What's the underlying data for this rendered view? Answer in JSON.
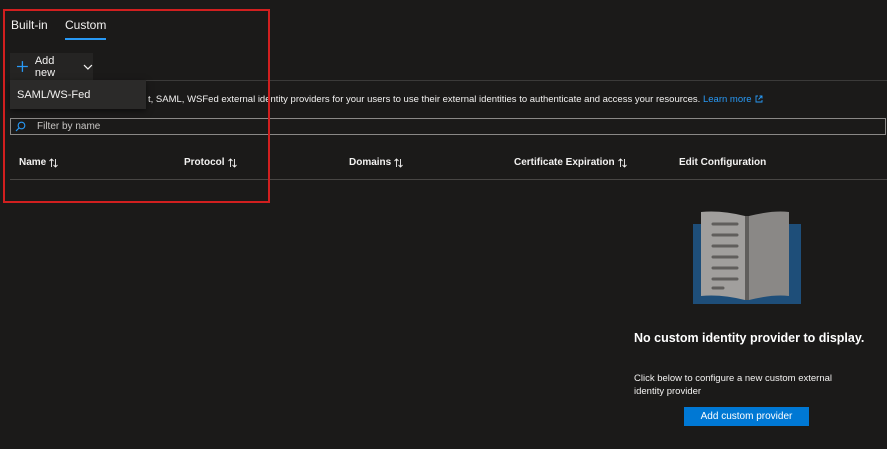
{
  "tabs": [
    {
      "label": "Built-in",
      "active": false
    },
    {
      "label": "Custom",
      "active": true
    }
  ],
  "toolbar": {
    "add_new_label": "Add new",
    "dropdown_items": [
      "SAML/WS-Fed"
    ]
  },
  "description": {
    "text": "t, SAML, WSFed external identity providers for your users to use their external identities to authenticate and access your resources.",
    "learn_more": "Learn more"
  },
  "filter": {
    "placeholder": "Filter by name"
  },
  "table": {
    "columns": [
      "Name",
      "Protocol",
      "Domains",
      "Certificate Expiration",
      "Edit Configuration"
    ]
  },
  "empty_state": {
    "title": "No custom identity provider to display.",
    "description": "Click below to configure a new custom external identity provider",
    "button_label": "Add custom provider"
  },
  "colors": {
    "background": "#1b1a19",
    "accent": "#0078d4",
    "link": "#2899f5",
    "annotation": "#d11f1f"
  }
}
